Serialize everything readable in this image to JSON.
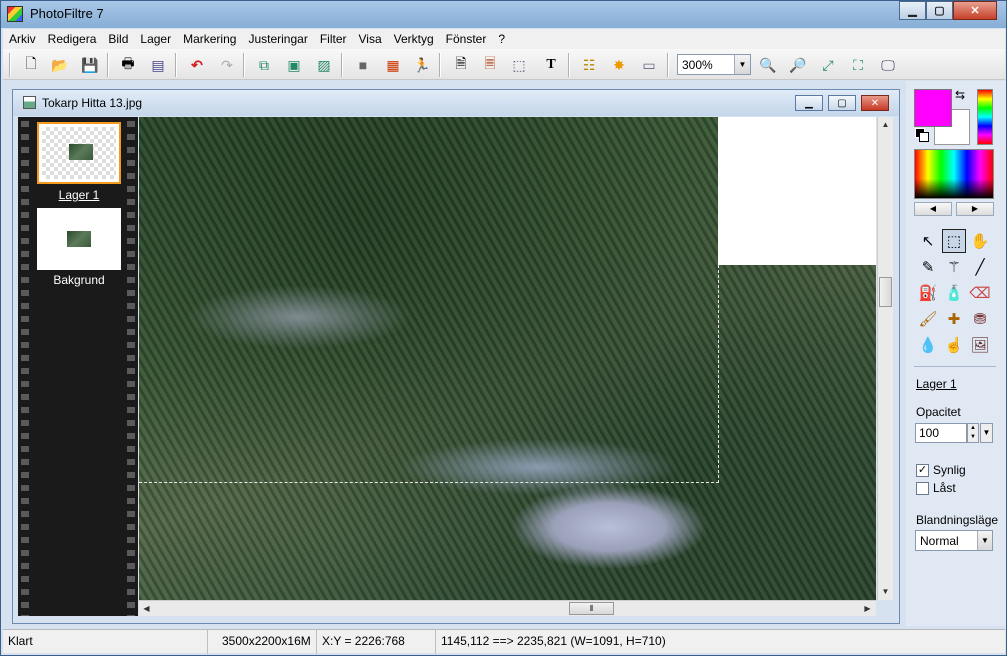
{
  "app": {
    "title": "PhotoFiltre 7"
  },
  "menu": [
    "Arkiv",
    "Redigera",
    "Bild",
    "Lager",
    "Markering",
    "Justeringar",
    "Filter",
    "Visa",
    "Verktyg",
    "Fönster",
    "?"
  ],
  "toolbar": {
    "zoom": "300%"
  },
  "document": {
    "title": "Tokarp Hitta 13.jpg"
  },
  "layers": [
    {
      "label": "Lager 1",
      "active": true
    },
    {
      "label": "Bakgrund",
      "active": false
    }
  ],
  "colors": {
    "foreground": "#ff00ff",
    "background": "#ffffff",
    "selection_border": "#f39a1f"
  },
  "props": {
    "layer_link": "Lager 1",
    "opacity_label": "Opacitet",
    "opacity_value": "100",
    "visible_label": "Synlig",
    "visible_checked": true,
    "locked_label": "Låst",
    "locked_checked": false,
    "blend_label": "Blandningsläge",
    "blend_value": "Normal"
  },
  "status": {
    "state": "Klart",
    "image_info": "3500x2200x16M",
    "coords": "X:Y = 2226:768",
    "selection": "1145,112 ==> 2235,821 (W=1091, H=710)"
  },
  "icons": {
    "toolbar": [
      "new-file-icon",
      "open-folder-icon",
      "save-icon",
      "print-icon",
      "scan-icon",
      "undo-icon",
      "redo-icon",
      "copy-layer-icon",
      "paste-layer-icon",
      "image-icon",
      "grayscale-icon",
      "rgb-icon",
      "run-icon",
      "document-text-icon",
      "document-icon",
      "selection-icon",
      "text-icon",
      "layers-icon",
      "star-icon",
      "window-icon",
      "zoom-in-icon",
      "zoom-out-icon",
      "fit-icon",
      "fullsize-icon",
      "display-icon"
    ],
    "tools": [
      "pointer-icon",
      "selection-tool-icon",
      "hand-icon",
      "eyedropper-icon",
      "magic-wand-icon",
      "line-icon",
      "fill-bucket-icon",
      "spray-icon",
      "eraser-icon",
      "brush-icon",
      "advanced-brush-icon",
      "stamp-icon",
      "blur-drop-icon",
      "smudge-icon",
      "portrait-icon"
    ]
  }
}
